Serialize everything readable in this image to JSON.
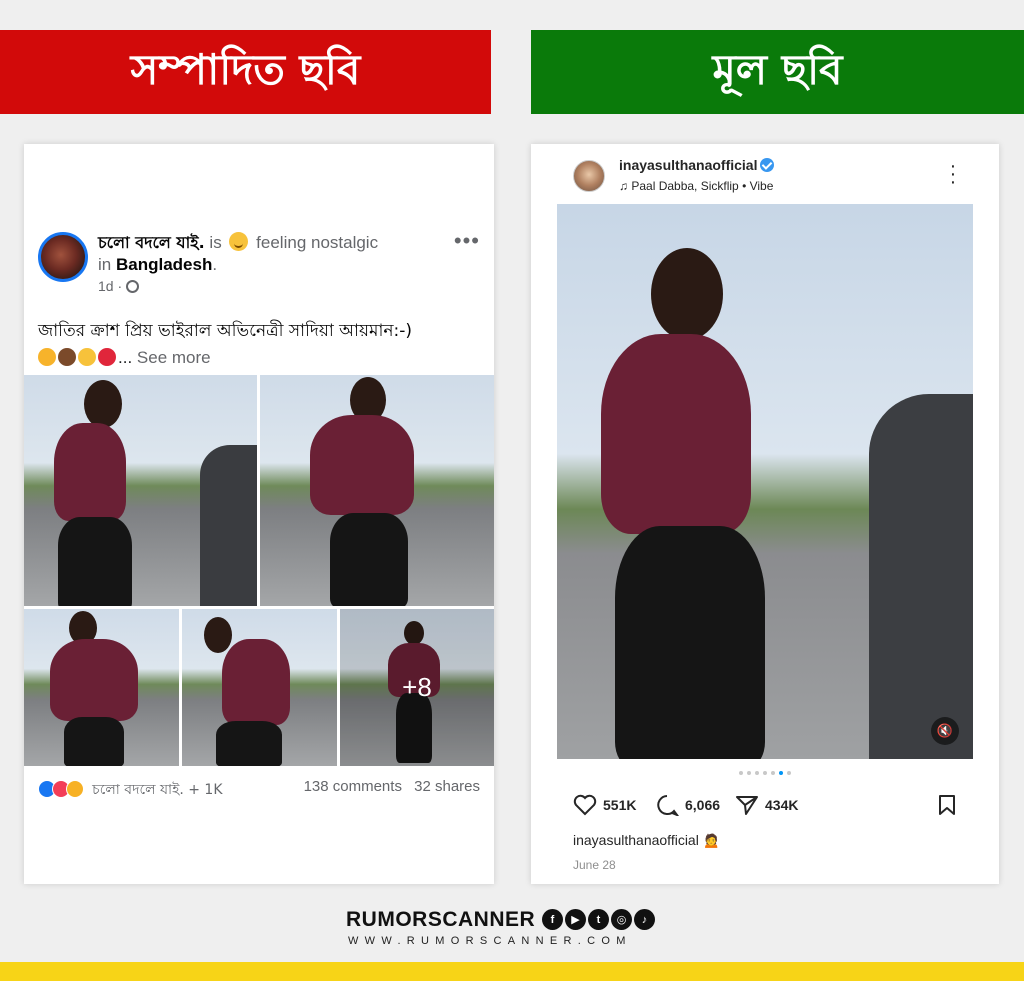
{
  "banners": {
    "left": "সম্পাদিত ছবি",
    "right": "মূল ছবি"
  },
  "facebook_post": {
    "page_name": "চলো বদলে যাই.",
    "is_word": "is",
    "feeling": "feeling nostalgic",
    "in_word": "in",
    "place": "Bangladesh",
    "period": ".",
    "time": "1d ·",
    "more": "•••",
    "text": "জাতির ক্রাশ প্রিয় ভাইরাল অভিনেত্রী সাদিয়া আয়মান:-)",
    "emoji_ellipsis": "...",
    "see_more": "See more",
    "plus_count": "+8",
    "reactions_names": "চলো বদলে যাই. + 1K",
    "comments": "138 comments",
    "shares": "32 shares",
    "colors": {
      "like": "#1877f2",
      "love": "#f33e58",
      "wow": "#f7b125",
      "avatar_ring": "#1877f2"
    }
  },
  "instagram_post": {
    "username": "inayasulthanaofficial",
    "music": "Paal Dabba, Sickflip • Vibe",
    "likes": "551K",
    "comments": "6,066",
    "shares": "434K",
    "caption_user": "inayasulthanaofficial",
    "caption_emoji": "🙍",
    "date": "June 28",
    "carousel_total": 7,
    "carousel_active": 6,
    "icons": [
      "heart-icon",
      "comment-icon",
      "send-icon",
      "bookmark-icon",
      "mute-icon",
      "music-icon",
      "verified-icon"
    ],
    "colors": {
      "verified": "#3897f0",
      "carousel_active": "#0095f6"
    }
  },
  "brand": {
    "name": "RUMORSCANNER",
    "url": "WWW.RUMORSCANNER.COM",
    "social_icons": [
      "f",
      "▶",
      "t",
      "◎",
      "♪"
    ]
  },
  "colors": {
    "banner_left": "#d20a0a",
    "banner_right": "#0a7a0a",
    "bottom_bar": "#f7d417"
  }
}
